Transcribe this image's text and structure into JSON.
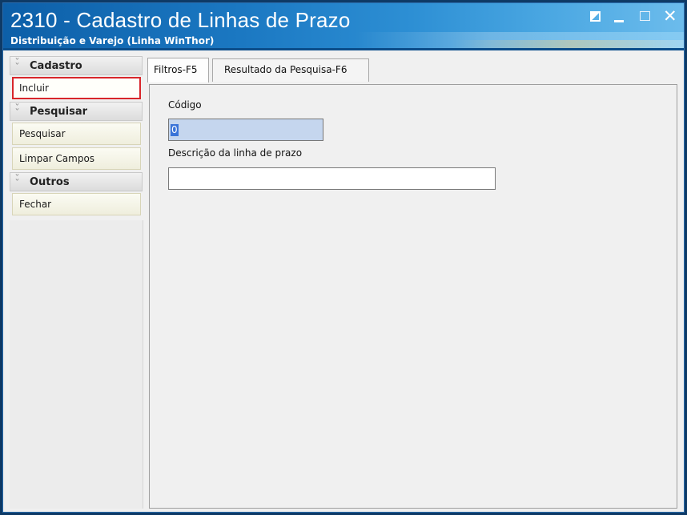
{
  "window": {
    "title": "2310 - Cadastro de Linhas de Prazo",
    "subtitle": "Distribuição e Varejo (Linha WinThor)"
  },
  "sidebar": {
    "groups": [
      {
        "label": "Cadastro",
        "items": [
          {
            "label": "Incluir",
            "selected": true
          }
        ]
      },
      {
        "label": "Pesquisar",
        "items": [
          {
            "label": "Pesquisar"
          },
          {
            "label": "Limpar Campos"
          }
        ]
      },
      {
        "label": "Outros",
        "items": [
          {
            "label": "Fechar"
          }
        ]
      }
    ]
  },
  "tabs": [
    {
      "label": "Filtros-F5",
      "active": true
    },
    {
      "label": "Resultado da Pesquisa-F6",
      "active": false
    }
  ],
  "form": {
    "codigo_label": "Código",
    "codigo_value": "0",
    "descricao_label": "Descrição da linha de prazo",
    "descricao_value": ""
  },
  "icons": {
    "group_collapse": "chevron-double-down-icon",
    "restore": "restore-icon",
    "minimize": "minimize-icon",
    "maximize": "maximize-icon",
    "close": "close-icon"
  },
  "colors": {
    "titlebar": "#1b78c2",
    "selection_border": "#d8262b",
    "selected_text_bg": "#3a74d8"
  }
}
